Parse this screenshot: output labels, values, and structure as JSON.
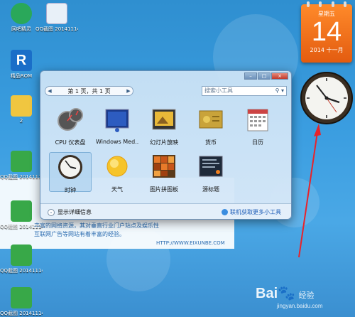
{
  "desktop_icons": [
    {
      "label": "网吧精灵",
      "color": "#2aa85a"
    },
    {
      "label": "QQ截图\n20141114...",
      "color": "#e8f0f8"
    },
    {
      "label": "精品ROM",
      "color": "#1a6ec8"
    },
    {
      "label": "2",
      "color": "#f0c640"
    },
    {
      "label": "QQ截图\n20141114...",
      "color": "#38a848"
    },
    {
      "label": "QQ截图\n20141114...",
      "color": "#38a848"
    },
    {
      "label": "QQ截图\n20141114...",
      "color": "#38a848"
    },
    {
      "label": "QQ截图\n20141114...",
      "color": "#38a848"
    }
  ],
  "calendar": {
    "weekday": "星期五",
    "day": "14",
    "year_month": "2014 十一月"
  },
  "gadget_window": {
    "pager_text": "第 1 页，共 1 页",
    "search_placeholder": "搜索小工具",
    "items": [
      {
        "label": "CPU 仪表盘"
      },
      {
        "label": "Windows Med..."
      },
      {
        "label": "幻灯片放映"
      },
      {
        "label": "货币"
      },
      {
        "label": "日历"
      },
      {
        "label": "时钟"
      },
      {
        "label": "天气"
      },
      {
        "label": "图片拼图板"
      },
      {
        "label": "源标题"
      }
    ],
    "show_details": "显示详细信息",
    "get_online": "联机获取更多小工具"
  },
  "website_bg": {
    "line1": "丰富的网络资源，其对垂直行业门户站点及娱乐性",
    "line2": "互联网广告等网站有着丰富的经验。",
    "url": "HTTP://WWW.EIXUNBE.COM"
  },
  "watermark": {
    "logo": "Bai",
    "jingyan": "经验",
    "site": "jingyan.baidu.com"
  }
}
